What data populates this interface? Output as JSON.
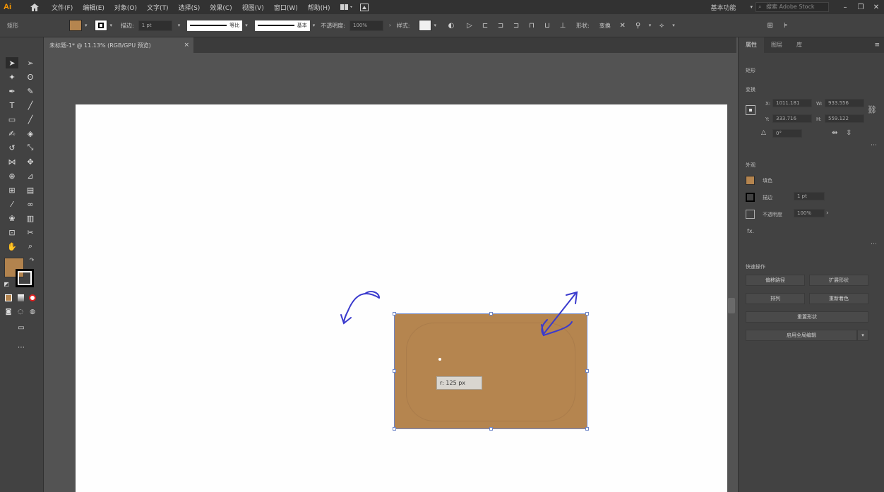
{
  "app": {
    "logo": "Ai"
  },
  "menu": [
    "文件(F)",
    "编辑(E)",
    "对象(O)",
    "文字(T)",
    "选择(S)",
    "效果(C)",
    "视图(V)",
    "窗口(W)",
    "帮助(H)"
  ],
  "workspace": "基本功能",
  "search": {
    "placeholder": "搜索 Adobe Stock"
  },
  "controlbar": {
    "selection_label": "矩形",
    "stroke_label": "描边:",
    "stroke_value": "1 pt",
    "profile1": "等比",
    "profile2": "基本",
    "opacity_label": "不透明度:",
    "opacity_value": "100%",
    "style_label": "样式:",
    "shape_label": "形状:",
    "transform_label": "变换"
  },
  "document_tab": {
    "title": "未标题-1* @ 11.13% (RGB/GPU 预览)"
  },
  "canvas": {
    "tooltip": "r: 125 px"
  },
  "panel": {
    "tabs": [
      "属性",
      "图层",
      "库"
    ],
    "section_rect": "矩形",
    "section_transform": "变换",
    "x_label": "X:",
    "x_value": "1011.181",
    "y_label": "Y:",
    "y_value": "333.716",
    "w_label": "W:",
    "w_value": "933.556",
    "h_label": "H:",
    "h_value": "559.122",
    "angle_value": "0°",
    "section_appearance": "外观",
    "fill_label": "填色",
    "stroke_label": "描边",
    "stroke_value": "1 pt",
    "opacity_label": "不透明度",
    "opacity_value": "100%",
    "fx_label": "fx.",
    "section_quick": "快速操作",
    "btn_offset": "偏移路径",
    "btn_expand": "扩展形状",
    "btn_arrange": "排列",
    "btn_recolor": "重新着色",
    "btn_reset": "重置形状",
    "btn_global": "启用全局编辑"
  },
  "colors": {
    "fill": "#b5854f",
    "selection": "#6f86c7",
    "artboard": "#fefefe",
    "ui_dark": "#424242",
    "logo": "#ff9a00"
  }
}
